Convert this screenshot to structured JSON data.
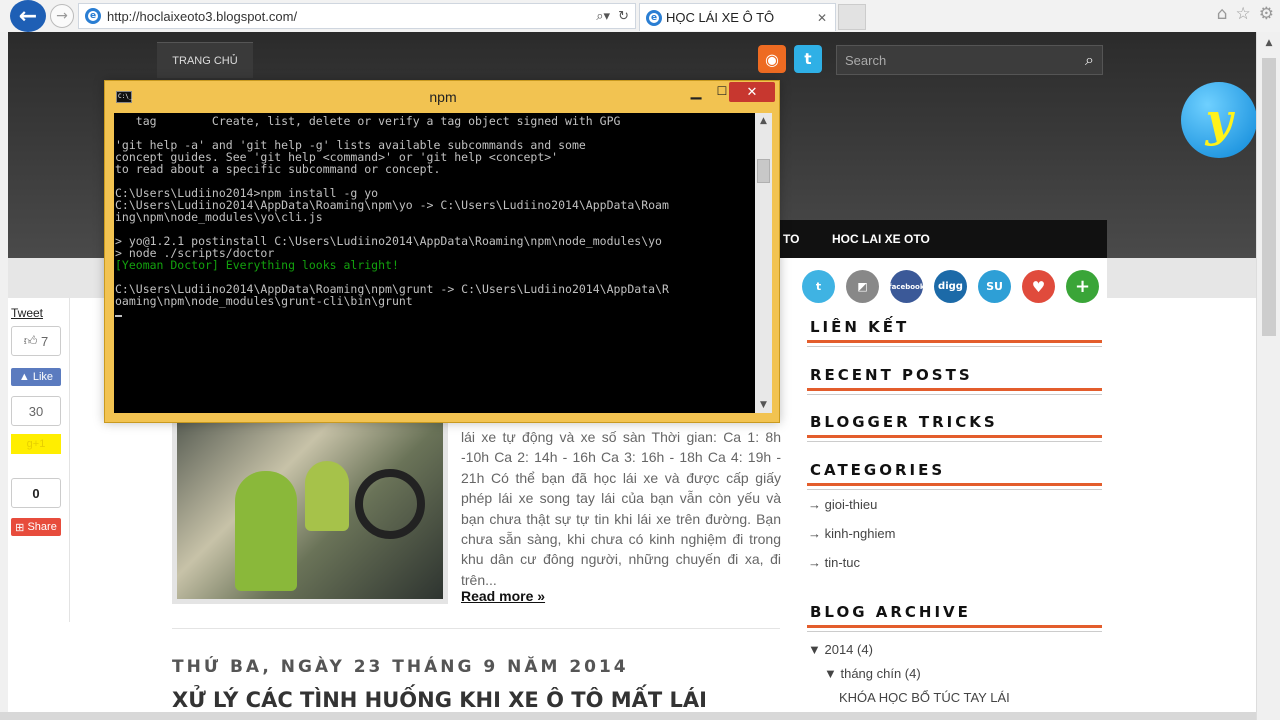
{
  "browser": {
    "url": "http://hoclaixeoto3.blogspot.com/",
    "tab_title": "HỌC LÁI XE Ô TÔ",
    "tab_close": "✕",
    "back_glyph": "←",
    "forward_glyph": "→",
    "addr_tools": [
      "⌕▾",
      "↻"
    ],
    "right_icons": [
      "⌂",
      "☆",
      "⚙"
    ]
  },
  "header": {
    "nav_home": "TRANG CHỦ",
    "search_placeholder": "Search",
    "logo_text": "y"
  },
  "menu": {
    "items": [
      "TO",
      "HOC LAI XE OTO"
    ]
  },
  "share": {
    "tweet": "Tweet",
    "like_count": "7",
    "like_label": "Like",
    "plus_count": "30",
    "gplus_label": "g+1",
    "share_count": "0",
    "share_label": "Share"
  },
  "post": {
    "excerpt": "lái xe tự động và xe số sàn Thời gian:  Ca 1: 8h -10h                 Ca 2: 14h - 16h               Ca 3: 16h - 18h                Ca 4: 19h - 21h Có thể bạn đã học lái xe và được cấp giấy phép lái xe song tay lái của bạn vẫn còn yếu và bạn chưa thật sự tự tin khi lái xe trên đường. Bạn chưa sẵn sàng, khi chưa có kinh nghiệm đi trong khu dân cư đông người, những chuyến đi xa, đi trên...",
    "read_more": "Read more »",
    "date_header": "THỨ BA, NGÀY 23 THÁNG 9 NĂM 2014",
    "next_title": "XỬ LÝ CÁC TÌNH HUỐNG KHI XE Ô TÔ MẤT LÁI"
  },
  "sidebar": {
    "social": [
      {
        "glyph": "t",
        "color": "#3fb3e3"
      },
      {
        "glyph": "◩",
        "color": "#888888"
      },
      {
        "glyph": "facebook",
        "color": "#3b5998"
      },
      {
        "glyph": "digg",
        "color": "#1c6aa8"
      },
      {
        "glyph": "SU",
        "color": "#2e9fd6"
      },
      {
        "glyph": "♥",
        "color": "#e04b3c"
      },
      {
        "glyph": "+",
        "color": "#3aa538"
      }
    ],
    "headings": [
      "LIÊN KẾT",
      "RECENT POSTS",
      "BLOGGER TRICKS",
      "CATEGORIES",
      "BLOG ARCHIVE"
    ],
    "categories": [
      "→ gioi-thieu",
      "→ kinh-nghiem",
      "→ tin-tuc"
    ],
    "archive_year": "▼  2014 (4)",
    "archive_month": "▼  tháng chín (4)",
    "archive_post": "KHÓA HỌC BỔ TÚC TAY LÁI"
  },
  "terminal": {
    "title": "npm",
    "icon_text": "C:\\_",
    "min": "▁",
    "max": "☐",
    "close": "✕",
    "lines_top": "   tag        Create, list, delete or verify a tag object signed with GPG\n\n'git help -a' and 'git help -g' lists available subcommands and some\nconcept guides. See 'git help <command>' or 'git help <concept>'\nto read about a specific subcommand or concept.\n\nC:\\Users\\Ludiino2014>npm install -g yo\nC:\\Users\\Ludiino2014\\AppData\\Roaming\\npm\\yo -> C:\\Users\\Ludiino2014\\AppData\\Roam\ning\\npm\\node_modules\\yo\\cli.js\n\n> yo@1.2.1 postinstall C:\\Users\\Ludiino2014\\AppData\\Roaming\\npm\\node_modules\\yo\n> node ./scripts/doctor\n",
    "doctor_line": "[Yeoman Doctor] Everything looks alright!",
    "lines_bottom": "C:\\Users\\Ludiino2014\\AppData\\Roaming\\npm\\grunt -> C:\\Users\\Ludiino2014\\AppData\\R\noaming\\npm\\node_modules\\grunt-cli\\bin\\grunt",
    "scroll_up": "▲",
    "scroll_down": "▼"
  },
  "scrollbar": {
    "up": "▲"
  }
}
